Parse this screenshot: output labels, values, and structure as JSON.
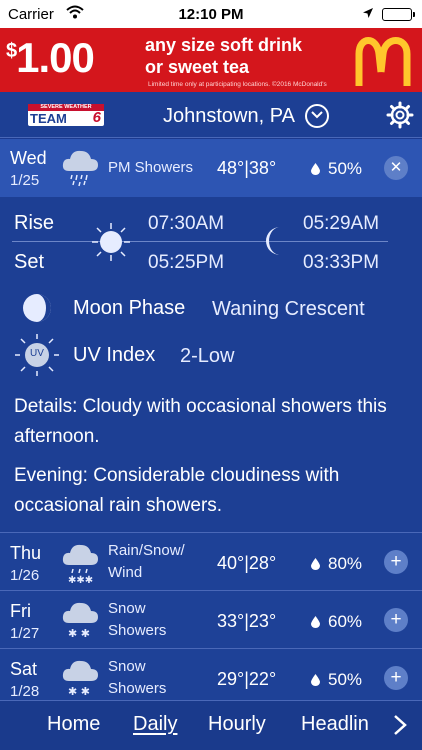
{
  "status_bar": {
    "carrier": "Carrier",
    "time": "12:10 PM"
  },
  "ad": {
    "price_symbol": "$",
    "price": "1.00",
    "line1": "any size soft drink",
    "line2": "or sweet tea",
    "fine_print": "Limited time only at participating locations. ©2016 McDonald's",
    "brand_color": "#d4161c",
    "logo_color": "#ffc72c"
  },
  "header": {
    "logo_top": "SEVERE WEATHER",
    "logo_main": "TEAM",
    "logo_number": "6",
    "city": "Johnstown, PA"
  },
  "today": {
    "day": "Wed",
    "date": "1/25",
    "condition": "PM Showers",
    "high": "48°",
    "low": "38°",
    "precip": "50%"
  },
  "details": {
    "rise_label": "Rise",
    "set_label": "Set",
    "sun_rise": "07:30AM",
    "sun_set": "05:25PM",
    "moon_rise": "05:29AM",
    "moon_set": "03:33PM",
    "moon_phase_label": "Moon Phase",
    "moon_phase_value": "Waning Crescent",
    "uv_badge": "UV",
    "uv_label": "UV Index",
    "uv_value": "2-Low",
    "details_text": "Details: Cloudy with occasional showers this afternoon.",
    "evening_text": "Evening: Considerable cloudiness with occasional rain showers."
  },
  "forecast": [
    {
      "day": "Thu",
      "date": "1/26",
      "condition_line1": "Rain/Snow/",
      "condition_line2": "Wind",
      "high": "40°",
      "low": "28°",
      "precip": "80%"
    },
    {
      "day": "Fri",
      "date": "1/27",
      "condition_line1": "Snow",
      "condition_line2": "Showers",
      "high": "33°",
      "low": "23°",
      "precip": "60%"
    },
    {
      "day": "Sat",
      "date": "1/28",
      "condition_line1": "Snow",
      "condition_line2": "Showers",
      "high": "29°",
      "low": "22°",
      "precip": "50%"
    }
  ],
  "nav": {
    "home": "Home",
    "daily": "Daily",
    "hourly": "Hourly",
    "headlines": "Headlin"
  },
  "colors": {
    "background": "#1c3a8f",
    "today_row": "#2d55b3",
    "accent_button": "#5e7fc8"
  }
}
